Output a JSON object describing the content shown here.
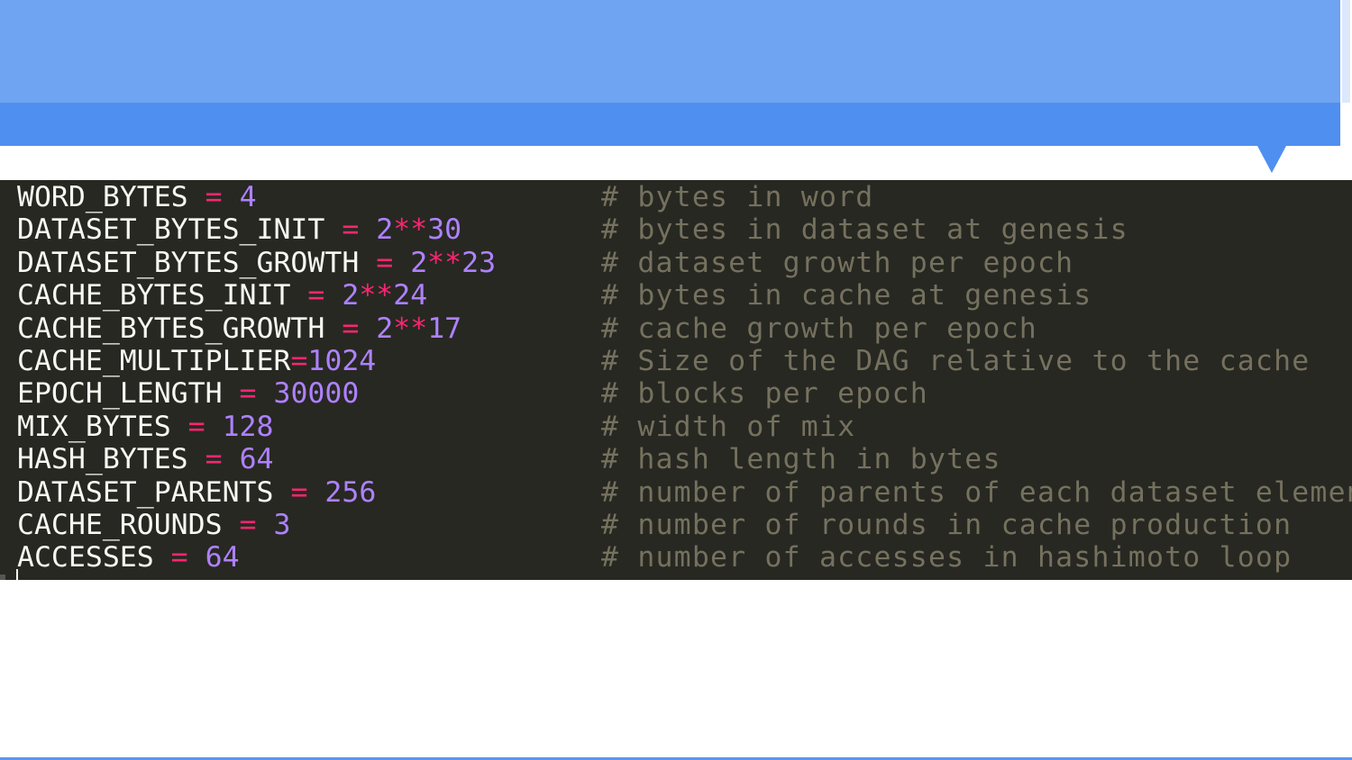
{
  "colors": {
    "banner_light": "#6fa4f2",
    "banner_dark": "#4f8ff0",
    "editor_background": "#272822",
    "identifier": "#f8f8f2",
    "operator": "#f92672",
    "number": "#ae81ff",
    "comment": "#75715e"
  },
  "code": {
    "lines": [
      {
        "name": "WORD_BYTES",
        "op": " = ",
        "value": "4",
        "comment": "# bytes in word"
      },
      {
        "name": "DATASET_BYTES_INIT",
        "op": " = ",
        "value": "2**30",
        "comment": "# bytes in dataset at genesis"
      },
      {
        "name": "DATASET_BYTES_GROWTH",
        "op": " = ",
        "value": "2**23",
        "comment": "# dataset growth per epoch"
      },
      {
        "name": "CACHE_BYTES_INIT",
        "op": " = ",
        "value": "2**24",
        "comment": "# bytes in cache at genesis"
      },
      {
        "name": "CACHE_BYTES_GROWTH",
        "op": " = ",
        "value": "2**17",
        "comment": "# cache growth per epoch"
      },
      {
        "name": "CACHE_MULTIPLIER",
        "op": "=",
        "value": "1024",
        "comment": "# Size of the DAG relative to the cache"
      },
      {
        "name": "EPOCH_LENGTH",
        "op": " = ",
        "value": "30000",
        "comment": "# blocks per epoch"
      },
      {
        "name": "MIX_BYTES",
        "op": " = ",
        "value": "128",
        "comment": "# width of mix"
      },
      {
        "name": "HASH_BYTES",
        "op": " = ",
        "value": "64",
        "comment": "# hash length in bytes"
      },
      {
        "name": "DATASET_PARENTS",
        "op": " = ",
        "value": "256",
        "comment": "# number of parents of each dataset element"
      },
      {
        "name": "CACHE_ROUNDS",
        "op": " = ",
        "value": "3",
        "comment": "# number of rounds in cache production"
      },
      {
        "name": "ACCESSES",
        "op": " = ",
        "value": "64",
        "comment": "# number of accesses in hashimoto loop"
      }
    ]
  }
}
